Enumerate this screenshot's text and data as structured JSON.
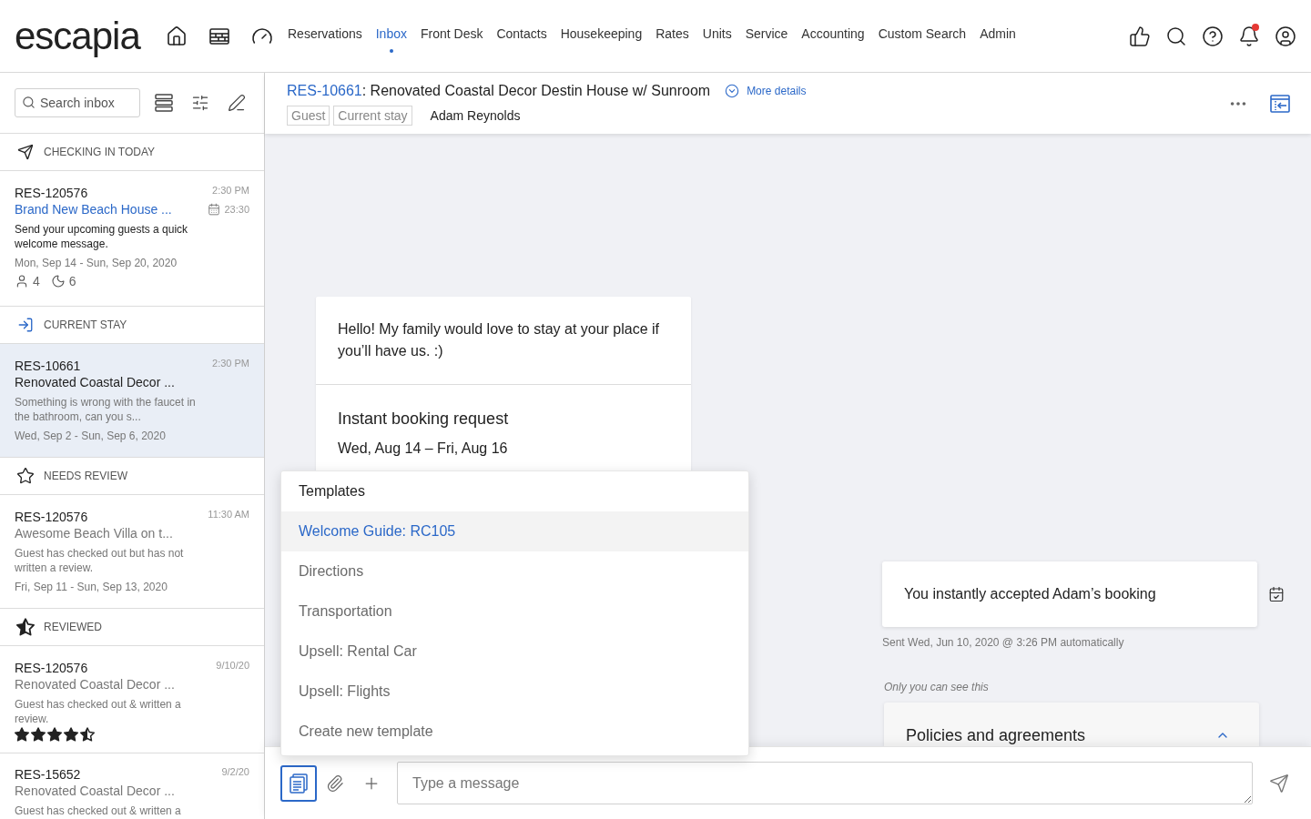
{
  "top_bar": {
    "logo": "escapia",
    "nav": [
      {
        "label": "Reservations",
        "selected": false
      },
      {
        "label": "Inbox",
        "selected": true
      },
      {
        "label": "Front Desk",
        "selected": false
      },
      {
        "label": "Contacts",
        "selected": false
      },
      {
        "label": "Housekeeping",
        "selected": false
      },
      {
        "label": "Rates",
        "selected": false
      },
      {
        "label": "Units",
        "selected": false
      },
      {
        "label": "Service",
        "selected": false
      },
      {
        "label": "Accounting",
        "selected": false
      },
      {
        "label": "Custom Search",
        "selected": false
      },
      {
        "label": "Admin",
        "selected": false
      }
    ],
    "notifications_unread": true
  },
  "sidebar": {
    "search": {
      "placeholder": "Search inbox"
    },
    "groups": [
      {
        "kind": "checking_in",
        "title": "CHECKING IN TODAY",
        "items": [
          {
            "id": "RES-120576",
            "name": "Brand New Beach House ...",
            "time": "2:30 PM",
            "checkin_time": "23:30",
            "message": "Send your upcoming guests a quick welcome message.",
            "dates": "Mon, Sep 14 - Sun, Sep 20, 2020",
            "guests": "4",
            "nights": "6",
            "unread": true,
            "selected": false
          }
        ]
      },
      {
        "kind": "current_stay",
        "title": "CURRENT STAY",
        "items": [
          {
            "id": "RES-10661",
            "name": "Renovated Coastal Decor ...",
            "time": "2:30 PM",
            "message": "Something is wrong with the faucet in the bathroom, can you s...",
            "dates": "Wed, Sep 2 - Sun, Sep 6, 2020",
            "unread": false,
            "selected": true
          }
        ]
      },
      {
        "kind": "needs_review",
        "title": "NEEDS REVIEW",
        "items": [
          {
            "id": "RES-120576",
            "name": "Awesome Beach Villa on t...",
            "time": "11:30 AM",
            "message": "Guest has checked out but has not written a review.",
            "dates": "Fri, Sep 11 - Sun, Sep 13, 2020",
            "unread": false,
            "selected": false
          }
        ]
      },
      {
        "kind": "reviewed",
        "title": "REVIEWED",
        "items": [
          {
            "id": "RES-120576",
            "name": "Renovated Coastal Decor ...",
            "time": "9/10/20",
            "message": "Guest has checked out & written a review.",
            "stars": 4.5,
            "unread": false,
            "selected": false
          },
          {
            "id": "RES-15652",
            "name": "Renovated Coastal Decor ...",
            "time": "9/2/20",
            "message": "Guest has checked out & written a",
            "unread": false,
            "selected": false
          }
        ]
      }
    ]
  },
  "conversation": {
    "id": "RES-10661",
    "title": ": Renovated Coastal Decor Destin House w/ Sunroom",
    "details_link": "More details",
    "tags": [
      "Guest",
      "Current stay"
    ],
    "guest": "Adam Reynolds"
  },
  "messages": [
    {
      "kind": "guest",
      "text": "Hello! My family would love to stay at your place if you’ll have us. :)",
      "booking": {
        "title": "Instant booking request",
        "dates": "Wed, Aug 14 – Fri, Aug 16"
      }
    },
    {
      "kind": "system",
      "text": "You instantly accepted Adam’s booking",
      "meta": "Sent Wed, Jun 10, 2020 @ 3:26 PM automatically"
    },
    {
      "kind": "private",
      "note": "Only you can see this",
      "title": "Policies and agreements",
      "expanded": true
    }
  ],
  "composer": {
    "placeholder": "Type a message"
  },
  "templates_menu": {
    "open": true,
    "title": "Templates",
    "items": [
      {
        "label": "Welcome Guide: RC105",
        "selected": true
      },
      {
        "label": "Directions",
        "selected": false
      },
      {
        "label": "Transportation",
        "selected": false
      },
      {
        "label": "Upsell: Rental Car",
        "selected": false
      },
      {
        "label": "Upsell: Flights",
        "selected": false
      },
      {
        "label": "Create new template",
        "selected": false
      }
    ]
  }
}
